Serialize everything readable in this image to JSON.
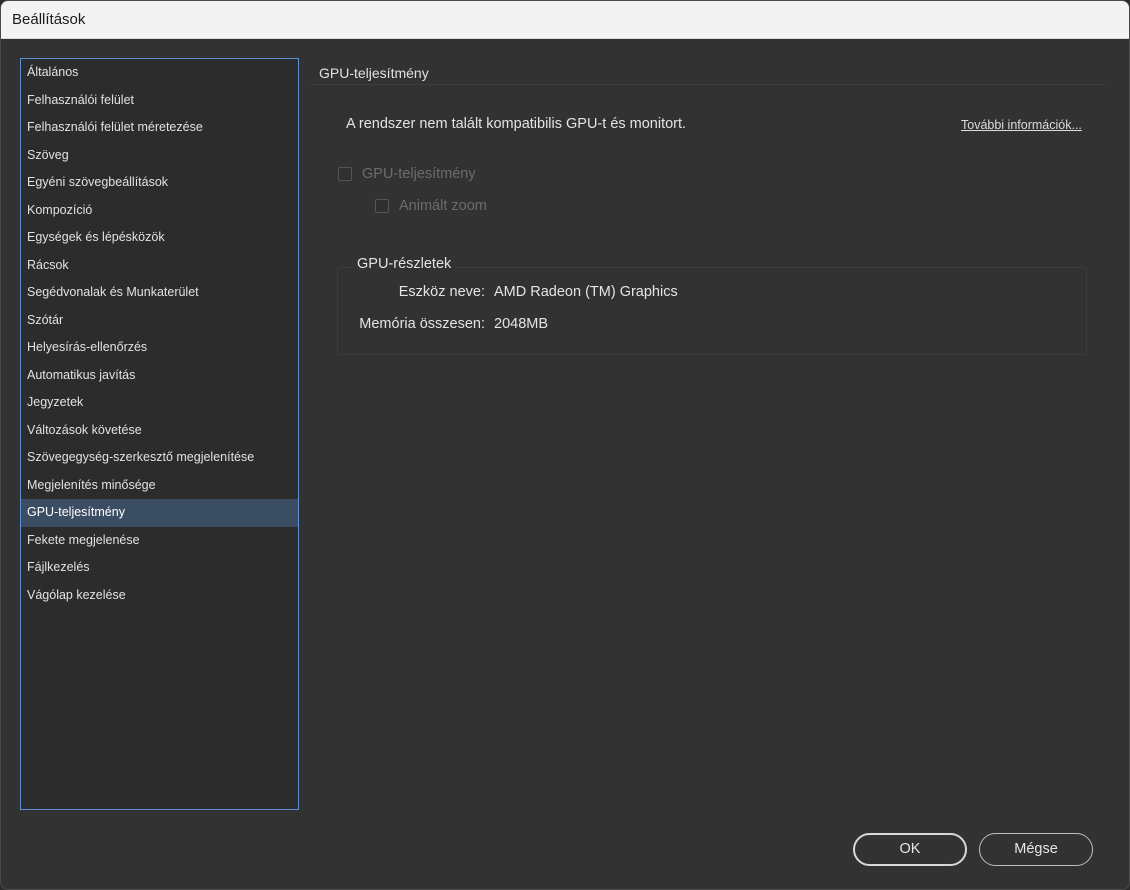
{
  "window": {
    "title": "Beállítások"
  },
  "sidebar": {
    "items": [
      "Általános",
      "Felhasználói felület",
      "Felhasználói felület méretezése",
      "Szöveg",
      "Egyéni szövegbeállítások",
      "Kompozíció",
      "Egységek és lépésközök",
      "Rácsok",
      "Segédvonalak és Munkaterület",
      "Szótár",
      "Helyesírás-ellenőrzés",
      "Automatikus javítás",
      "Jegyzetek",
      "Változások követése",
      "Szövegegység-szerkesztő megjelenítése",
      "Megjelenítés minősége",
      "GPU-teljesítmény",
      "Fekete megjelenése",
      "Fájlkezelés",
      "Vágólap kezelése"
    ],
    "selected_index": 16
  },
  "panel": {
    "title": "GPU-teljesítmény",
    "message": "A rendszer nem talált kompatibilis GPU-t és monitort.",
    "more_info_link": "További információk...",
    "gpu_checkbox_label": "GPU-teljesítmény",
    "animated_zoom_label": "Animált zoom",
    "details": {
      "title": "GPU-részletek",
      "device_name_label": "Eszköz neve:",
      "device_name_value": "AMD Radeon (TM) Graphics",
      "memory_label": "Memória összesen:",
      "memory_value": "2048MB"
    }
  },
  "buttons": {
    "ok": "OK",
    "cancel": "Mégse"
  }
}
